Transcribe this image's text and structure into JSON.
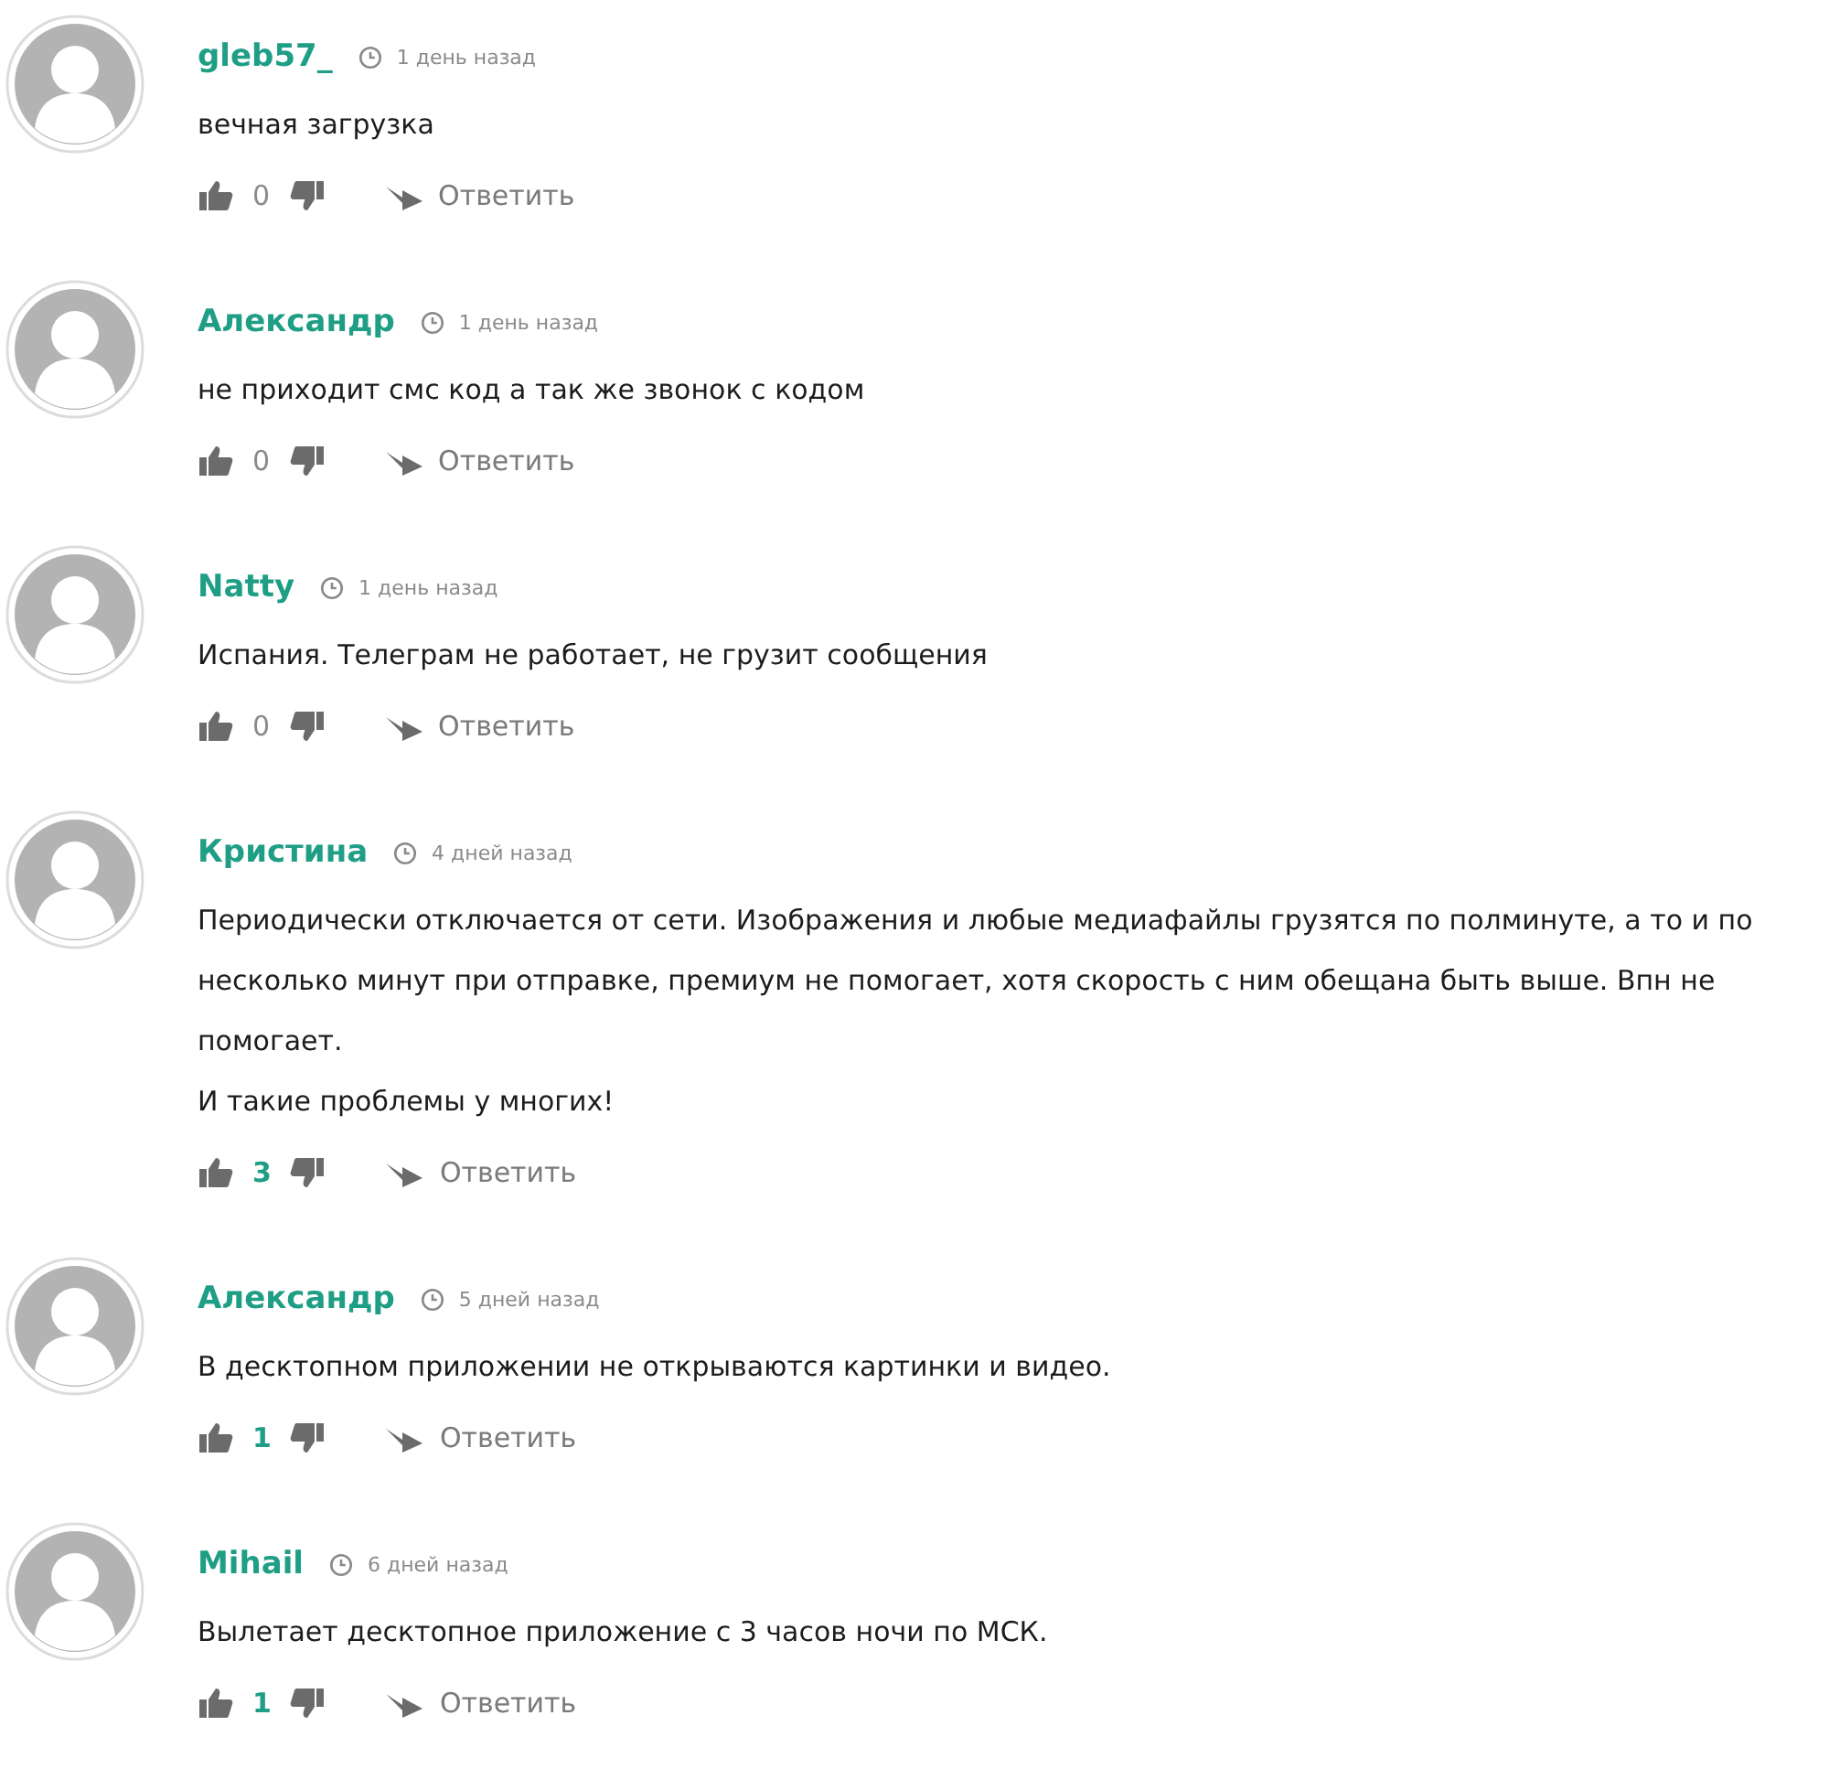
{
  "comments": [
    {
      "author": "gleb57_",
      "time": "1 день назад",
      "paragraphs": [
        "вечная загрузка"
      ],
      "votes": "0",
      "reply": "Ответить"
    },
    {
      "author": "Александр",
      "time": "1 день назад",
      "paragraphs": [
        "не приходит смс код а так же звонок с кодом"
      ],
      "votes": "0",
      "reply": "Ответить"
    },
    {
      "author": "Natty",
      "time": "1 день назад",
      "paragraphs": [
        "Испания. Телеграм не работает, не грузит сообщения"
      ],
      "votes": "0",
      "reply": "Ответить"
    },
    {
      "author": "Кристина",
      "time": "4 дней назад",
      "paragraphs": [
        "Периодически отключается от сети. Изображения и любые медиафайлы грузятся по полминуте, а то и по несколько минут при отправке, премиум не помогает, хотя скорость с ним обещана быть выше. Впн не помогает.",
        "И такие проблемы у многих!"
      ],
      "votes": "3",
      "reply": "Ответить"
    },
    {
      "author": "Александр",
      "time": "5 дней назад",
      "paragraphs": [
        "В десктопном приложении не открываются картинки и видео."
      ],
      "votes": "1",
      "reply": "Ответить"
    },
    {
      "author": "Mihail",
      "time": "6 дней назад",
      "paragraphs": [
        "Вылетает десктопное приложение с 3 часов ночи по МСК."
      ],
      "votes": "1",
      "reply": "Ответить"
    }
  ]
}
